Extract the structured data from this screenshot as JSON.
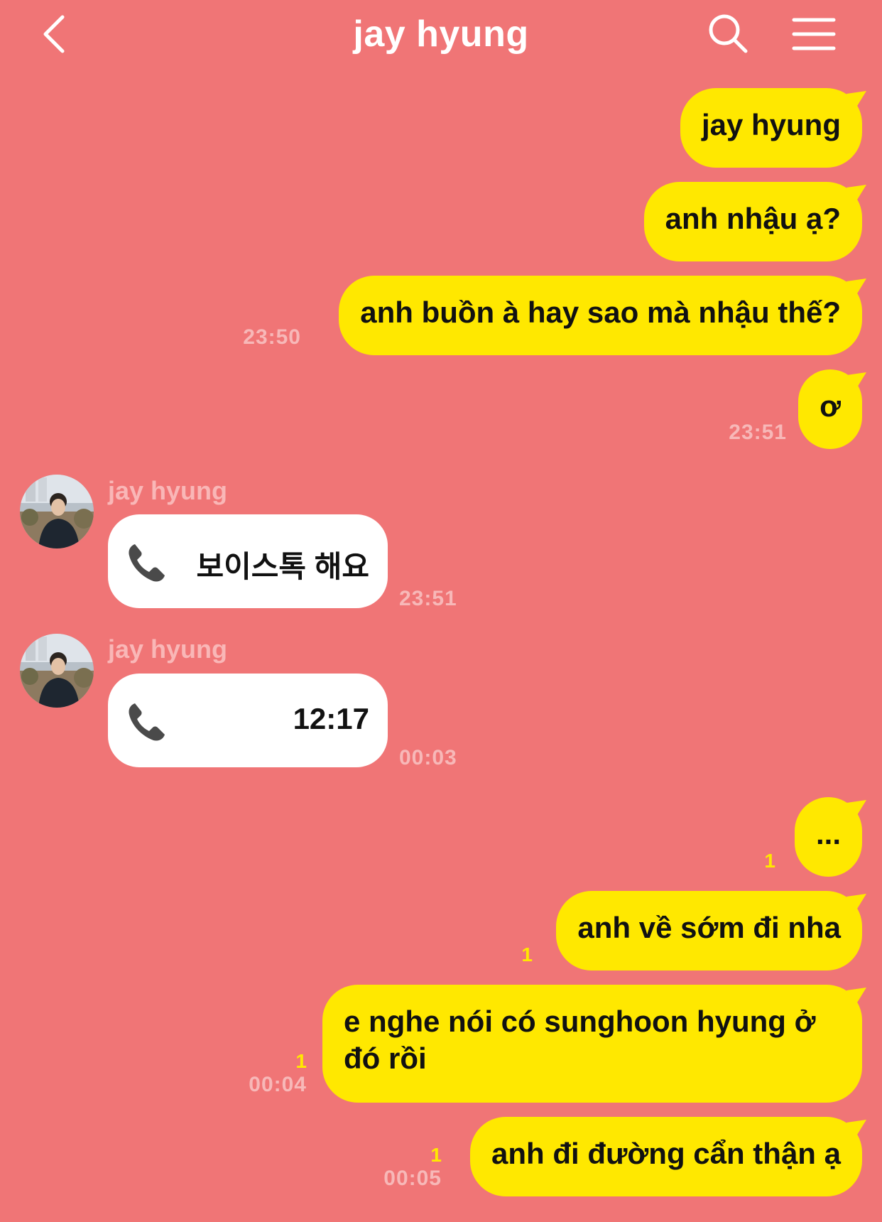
{
  "header": {
    "title": "jay hyung",
    "back_icon": "chevron-left-icon",
    "search_icon": "search-icon",
    "menu_icon": "hamburger-menu-icon"
  },
  "colors": {
    "background": "#f07576",
    "outgoing_bubble": "#ffe800",
    "incoming_bubble": "#ffffff",
    "unread_count": "#ffe800"
  },
  "messages": {
    "m1": {
      "text": "jay hyung"
    },
    "m2": {
      "text": "anh nhậu ạ?"
    },
    "m3": {
      "text": "anh buồn à hay sao mà nhậu thế?",
      "time": "23:50"
    },
    "m4": {
      "text": "ơ",
      "time": "23:51"
    },
    "c1": {
      "sender": "jay hyung",
      "text": "보이스톡 해요",
      "time": "23:51",
      "icon": "phone-icon"
    },
    "c2": {
      "sender": "jay hyung",
      "text": "12:17",
      "time": "00:03",
      "icon": "phone-icon"
    },
    "m5": {
      "text": "...",
      "unread": "1"
    },
    "m6": {
      "text": "anh về sớm đi nha",
      "unread": "1"
    },
    "m7": {
      "text": "e nghe nói có sunghoon hyung ở đó rồi",
      "unread": "1",
      "time": "00:04"
    },
    "m8": {
      "text": "anh đi đường cẩn thận ạ",
      "unread": "1",
      "time": "00:05"
    }
  }
}
